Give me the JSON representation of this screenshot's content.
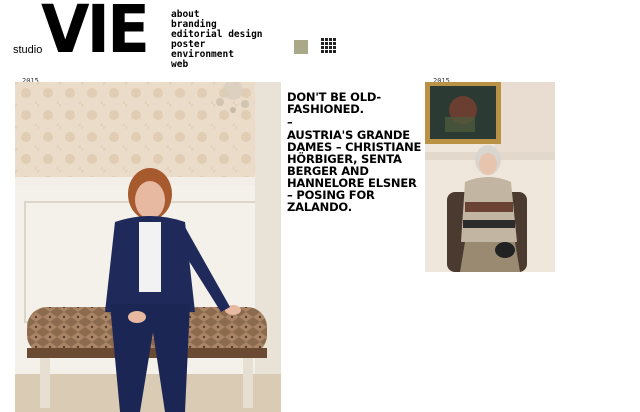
{
  "logo": {
    "small": "studio",
    "big": "VIE"
  },
  "nav": {
    "items": [
      "about",
      "branding",
      "editorial design",
      "poster",
      "environment",
      "web"
    ]
  },
  "view_toggle": {
    "single_icon": "square-icon",
    "grid_icon": "grid-icon",
    "accent": "#a9a98a"
  },
  "projects": [
    {
      "year": "2015"
    },
    {
      "year": "2015"
    }
  ],
  "caption": {
    "line1": "Don't be old-fashioned.",
    "dash": "–",
    "body": "Austria's grande dames – Christiane Hörbiger, Senta Berger and Hannelore Elsner – posing for Zalando."
  }
}
